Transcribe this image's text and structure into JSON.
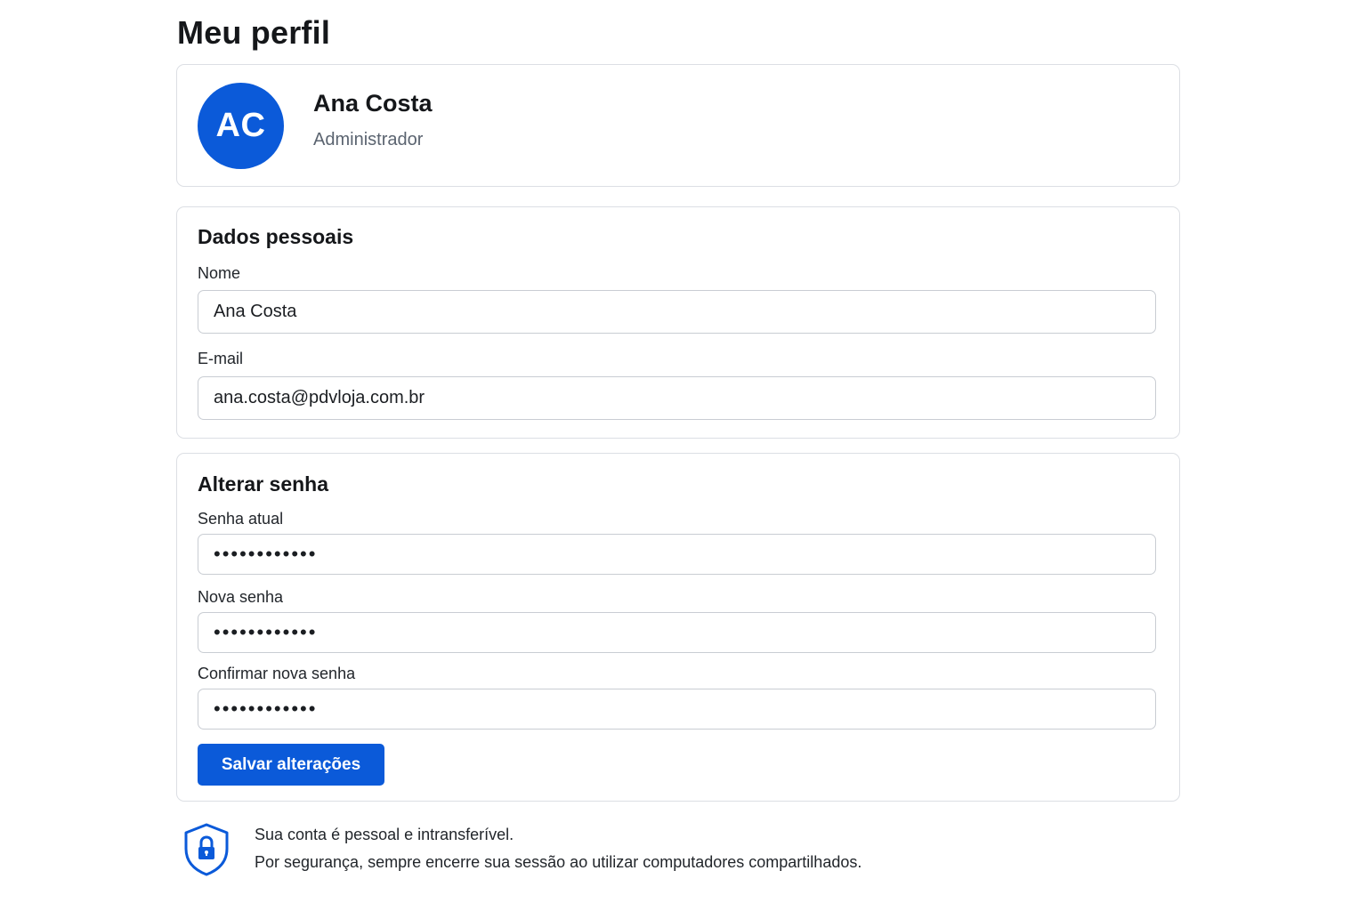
{
  "page": {
    "title": "Meu perfil"
  },
  "profile": {
    "initials": "AC",
    "name": "Ana Costa",
    "role": "Administrador",
    "avatar_color": "#0b5ad9"
  },
  "personal": {
    "title": "Dados pessoais",
    "name_label": "Nome",
    "name_value": "Ana Costa",
    "email_label": "E-mail",
    "email_value": "ana.costa@pdvloja.com.br"
  },
  "password": {
    "title": "Alterar senha",
    "current_label": "Senha atual",
    "current_value": "••••••••••••",
    "new_label": "Nova senha",
    "new_value": "••••••••••••",
    "confirm_label": "Confirmar nova senha",
    "confirm_value": "••••••••••••",
    "save_label": "Salvar alterações"
  },
  "notice": {
    "icon": "shield-lock-icon",
    "line1": "Sua conta é pessoal e intransferível.",
    "line2": "Por segurança, sempre encerre sua sessão ao utilizar computadores compartilhados."
  },
  "colors": {
    "accent": "#0b5ad9",
    "border": "#dcdfe4",
    "muted_text": "#5b6470"
  }
}
